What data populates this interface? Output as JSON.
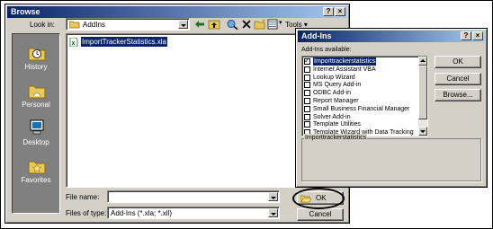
{
  "browse": {
    "title": "Browse",
    "help_btn": "?",
    "close_btn": "×",
    "look_in_label": "Look in:",
    "look_in_value": "AddIns",
    "tools_label": "Tools",
    "places": [
      {
        "label": "History"
      },
      {
        "label": "Personal"
      },
      {
        "label": "Desktop"
      },
      {
        "label": "Favorites"
      }
    ],
    "files": [
      "ImportTrackerStatistics.xla"
    ],
    "file_name_label": "File name:",
    "file_name_value": "",
    "files_of_type_label": "Files of type:",
    "files_of_type_value": "Add-Ins (*.xla; *.xll)",
    "ok_label": "OK",
    "cancel_label": "Cancel"
  },
  "addins": {
    "title": "Add-Ins",
    "help_btn": "?",
    "close_btn": "×",
    "available_label": "Add-Ins available:",
    "items": [
      {
        "label": "Importtrackerstatistics",
        "checked": true,
        "selected": true
      },
      {
        "label": "Internet Assistant VBA",
        "checked": false,
        "selected": false
      },
      {
        "label": "Lookup Wizard",
        "checked": false,
        "selected": false
      },
      {
        "label": "MS Query Add-in",
        "checked": false,
        "selected": false
      },
      {
        "label": "ODBC Add-in",
        "checked": false,
        "selected": false
      },
      {
        "label": "Report Manager",
        "checked": false,
        "selected": false
      },
      {
        "label": "Small Business Financial Manager",
        "checked": false,
        "selected": false
      },
      {
        "label": "Solver Add-in",
        "checked": false,
        "selected": false
      },
      {
        "label": "Template Utilities",
        "checked": false,
        "selected": false
      },
      {
        "label": "Template Wizard with Data Tracking",
        "checked": false,
        "selected": false
      }
    ],
    "ok_label": "OK",
    "cancel_label": "Cancel",
    "browse_label": "Browse...",
    "description_title": "Importtrackerstatistics"
  },
  "colors": {
    "titlebar_start": "#0a246a",
    "titlebar_end": "#a6caf0",
    "dialog_face": "#d4d0c8",
    "selection": "#0a246a"
  }
}
